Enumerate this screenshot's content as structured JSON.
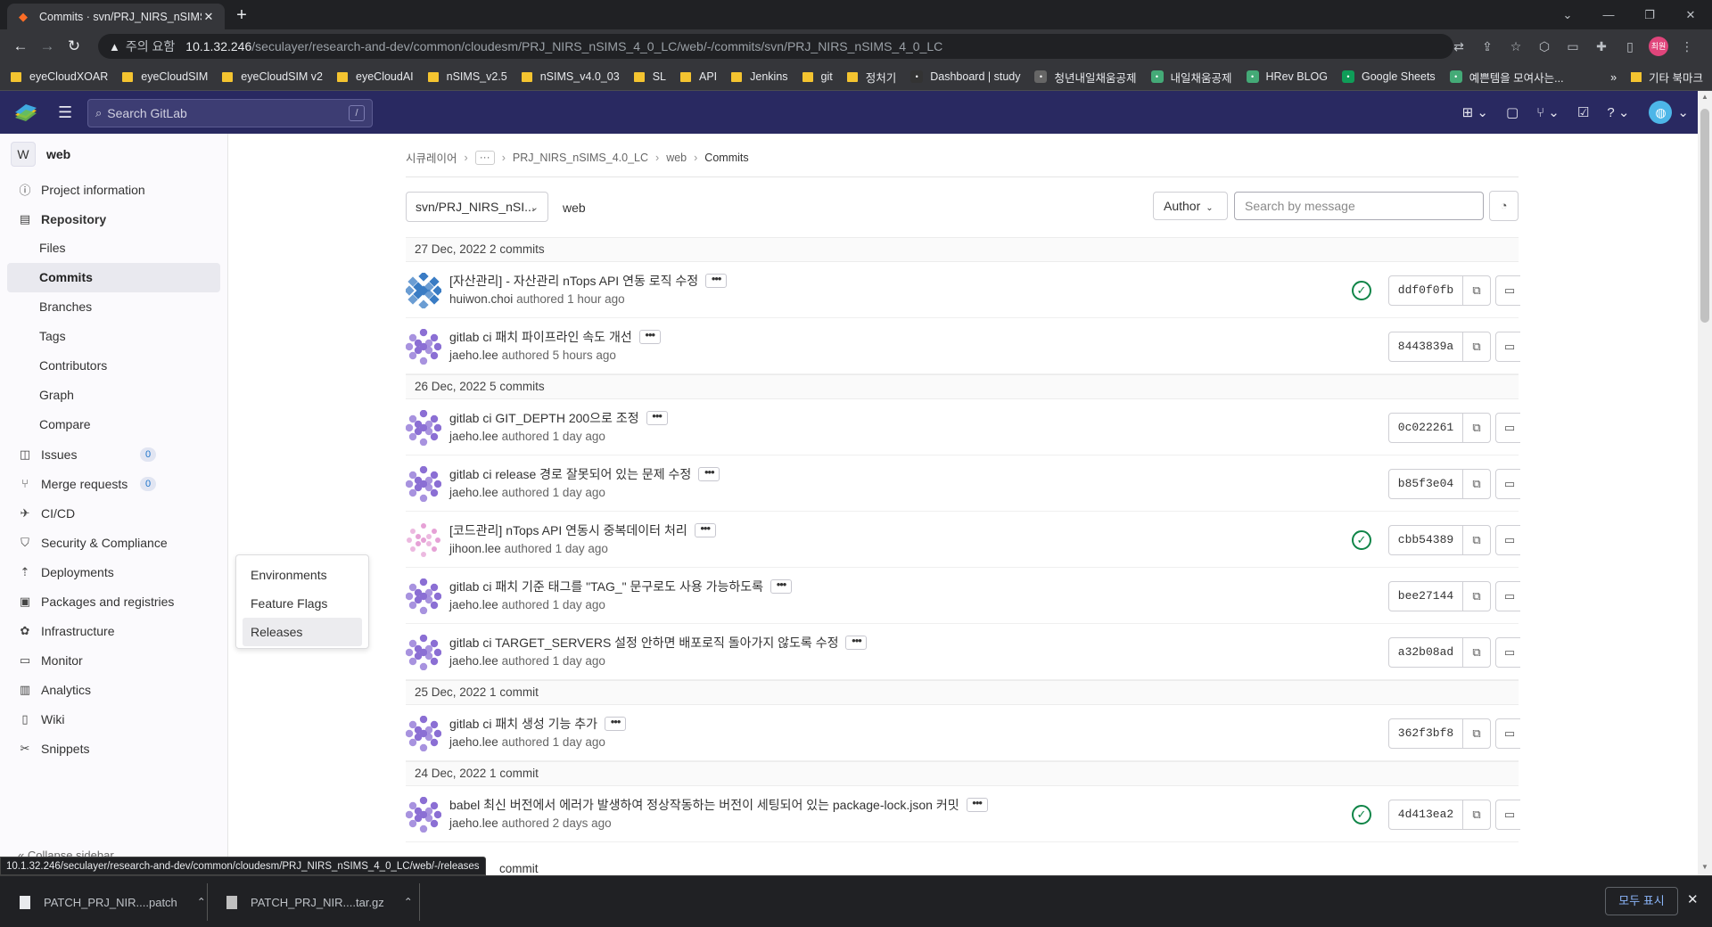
{
  "browser": {
    "tab_title": "Commits · svn/PRJ_NIRS_nSIMS",
    "security_warning": "주의 요함",
    "url_host": "10.1.32.246",
    "url_path": "/seculayer/research-and-dev/common/cloudesm/PRJ_NIRS_nSIMS_4_0_LC/web/-/commits/svn/PRJ_NIRS_nSIMS_4_0_LC",
    "profile_initials": "최원",
    "bookmarks": [
      {
        "label": "eyeCloudXOAR",
        "icon": "folder-icon"
      },
      {
        "label": "eyeCloudSIM",
        "icon": "folder-icon"
      },
      {
        "label": "eyeCloudSIM v2",
        "icon": "folder-icon"
      },
      {
        "label": "eyeCloudAI",
        "icon": "folder-icon"
      },
      {
        "label": "nSIMS_v2.5",
        "icon": "folder-icon"
      },
      {
        "label": "nSIMS_v4.0_03",
        "icon": "folder-icon"
      },
      {
        "label": "SL",
        "icon": "folder-icon"
      },
      {
        "label": "API",
        "icon": "folder-icon"
      },
      {
        "label": "Jenkins",
        "icon": "folder-icon"
      },
      {
        "label": "git",
        "icon": "folder-icon"
      },
      {
        "label": "정처기",
        "icon": "folder-icon"
      },
      {
        "label": "Dashboard | study",
        "icon": "github-icon"
      },
      {
        "label": "청년내일채움공제",
        "icon": "globe-icon"
      },
      {
        "label": "내일채움공제",
        "icon": "site-icon"
      },
      {
        "label": "HRev BLOG",
        "icon": "site-icon"
      },
      {
        "label": "Google Sheets",
        "icon": "sheets-icon"
      },
      {
        "label": "예쁜템을 모여사는...",
        "icon": "site-icon"
      }
    ],
    "bookmarks_overflow": "»",
    "other_bookmarks": "기타 북마크",
    "status_url": "10.1.32.246/seculayer/research-and-dev/common/cloudesm/PRJ_NIRS_nSIMS_4_0_LC/web/-/releases",
    "downloads": [
      {
        "name": "PATCH_PRJ_NIR....patch"
      },
      {
        "name": "PATCH_PRJ_NIR....tar.gz"
      }
    ],
    "show_all": "모두 표시"
  },
  "gitlab": {
    "search_placeholder": "Search GitLab",
    "search_shortcut": "/"
  },
  "sidebar": {
    "project_initial": "W",
    "project_name": "web",
    "items": [
      {
        "label": "Project information",
        "icon": "info-icon"
      },
      {
        "label": "Repository",
        "icon": "repository-icon"
      },
      {
        "label": "Issues",
        "icon": "issues-icon",
        "count": "0"
      },
      {
        "label": "Merge requests",
        "icon": "merge-request-icon",
        "count": "0"
      },
      {
        "label": "CI/CD",
        "icon": "rocket-icon"
      },
      {
        "label": "Security & Compliance",
        "icon": "shield-icon"
      },
      {
        "label": "Deployments",
        "icon": "deployments-icon"
      },
      {
        "label": "Packages and registries",
        "icon": "package-icon"
      },
      {
        "label": "Infrastructure",
        "icon": "cloud-gear-icon"
      },
      {
        "label": "Monitor",
        "icon": "monitor-icon"
      },
      {
        "label": "Analytics",
        "icon": "chart-icon"
      },
      {
        "label": "Wiki",
        "icon": "book-icon"
      },
      {
        "label": "Snippets",
        "icon": "scissors-icon"
      }
    ],
    "repository_sub": [
      "Files",
      "Commits",
      "Branches",
      "Tags",
      "Contributors",
      "Graph",
      "Compare"
    ],
    "collapse_label": "Collapse sidebar",
    "flyout": [
      "Environments",
      "Feature Flags",
      "Releases"
    ]
  },
  "main": {
    "breadcrumbs": [
      "시큐레이어",
      "PRJ_NIRS_nSIMS_4.0_LC",
      "web",
      "Commits"
    ],
    "branch": "svn/PRJ_NIRS_nSI...",
    "path": "web",
    "author_button": "Author",
    "search_placeholder": "Search by message",
    "days": [
      {
        "header": "27 Dec, 2022 2 commits",
        "commits": [
          {
            "title": "[자산관리] - 자산관리 nTops API 연동 로직 수정",
            "author": "huiwon.choi",
            "time": "authored 1 hour ago",
            "sha": "ddf0f0fb",
            "passed": true,
            "avatar": "blue"
          },
          {
            "title": "gitlab ci 패치 파이프라인 속도 개선",
            "author": "jaeho.lee",
            "time": "authored 5 hours ago",
            "sha": "8443839a",
            "passed": false,
            "avatar": "purple"
          }
        ]
      },
      {
        "header": "26 Dec, 2022 5 commits",
        "commits": [
          {
            "title": "gitlab ci GIT_DEPTH 200으로 조정",
            "author": "jaeho.lee",
            "time": "authored 1 day ago",
            "sha": "0c022261",
            "passed": false,
            "avatar": "purple"
          },
          {
            "title": "gitlab ci release 경로 잘못되어 있는 문제 수정",
            "author": "jaeho.lee",
            "time": "authored 1 day ago",
            "sha": "b85f3e04",
            "passed": false,
            "avatar": "purple"
          },
          {
            "title": "[코드관리] nTops API 연동시 중복데이터 처리",
            "author": "jihoon.lee",
            "time": "authored 1 day ago",
            "sha": "cbb54389",
            "passed": true,
            "avatar": "pink"
          },
          {
            "title": "gitlab ci 패치 기준 태그를 \"TAG_\" 문구로도 사용 가능하도록",
            "author": "jaeho.lee",
            "time": "authored 1 day ago",
            "sha": "bee27144",
            "passed": false,
            "avatar": "purple"
          },
          {
            "title": "gitlab ci TARGET_SERVERS 설정 안하면 배포로직 돌아가지 않도록 수정",
            "author": "jaeho.lee",
            "time": "authored 1 day ago",
            "sha": "a32b08ad",
            "passed": false,
            "avatar": "purple"
          }
        ]
      },
      {
        "header": "25 Dec, 2022 1 commit",
        "commits": [
          {
            "title": "gitlab ci 패치 생성 기능 추가",
            "author": "jaeho.lee",
            "time": "authored 1 day ago",
            "sha": "362f3bf8",
            "passed": false,
            "avatar": "purple"
          }
        ]
      },
      {
        "header": "24 Dec, 2022 1 commit",
        "commits": [
          {
            "title": "babel 최신 버전에서 에러가 발생하여 정상작동하는 버전이 세팅되어 있는 package-lock.json 커밋",
            "author": "jaeho.lee",
            "time": "authored 2 days ago",
            "sha": "4d413ea2",
            "passed": true,
            "avatar": "purple"
          }
        ]
      }
    ],
    "partial_next": "commit"
  },
  "colors": {
    "header": "#292961",
    "pipeline_success": "#108548",
    "purple_avatar": "#8b6fd4",
    "blue_avatar": "#3a7cc4",
    "pink_avatar": "#e6a1d6"
  }
}
